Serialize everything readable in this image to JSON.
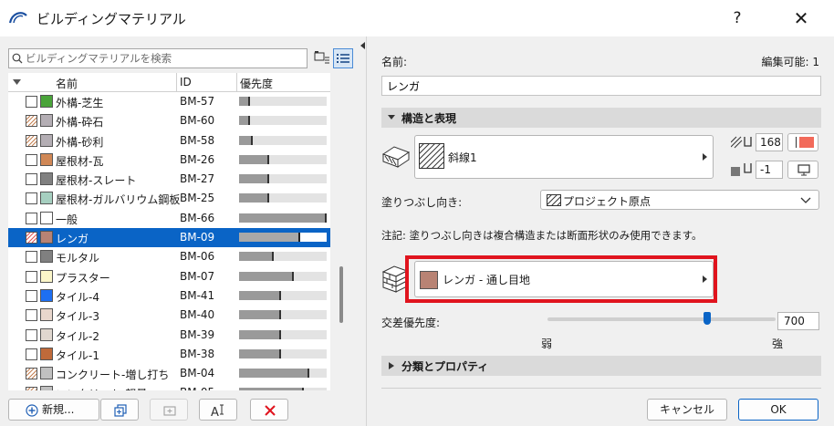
{
  "window": {
    "title": "ビルディングマテリアル",
    "help": "?",
    "close": "✕"
  },
  "search": {
    "placeholder": "ビルディングマテリアルを検索"
  },
  "list": {
    "headers": {
      "name": "名前",
      "id": "ID",
      "priority": "優先度"
    },
    "rows": [
      {
        "name": "外構-芝生",
        "id": "BM-57",
        "priority": 0.13,
        "swatch": "#4aa43a",
        "hatch": false,
        "selected": false
      },
      {
        "name": "外構-砕石",
        "id": "BM-60",
        "priority": 0.13,
        "swatch": "#b4aeb4",
        "hatch": true,
        "selected": false
      },
      {
        "name": "外構-砂利",
        "id": "BM-58",
        "priority": 0.16,
        "swatch": "#b4aeb4",
        "hatch": true,
        "selected": false
      },
      {
        "name": "屋根材-瓦",
        "id": "BM-26",
        "priority": 0.34,
        "swatch": "#d08856",
        "hatch": false,
        "selected": false
      },
      {
        "name": "屋根材-スレート",
        "id": "BM-27",
        "priority": 0.34,
        "swatch": "#808080",
        "hatch": false,
        "selected": false
      },
      {
        "name": "屋根材-ガルバリウム鋼板",
        "id": "BM-25",
        "priority": 0.34,
        "swatch": "#a6cfc0",
        "hatch": false,
        "selected": false
      },
      {
        "name": "一般",
        "id": "BM-66",
        "priority": 1.0,
        "swatch": "#ffffff",
        "hatch": false,
        "selected": false
      },
      {
        "name": "レンガ",
        "id": "BM-09",
        "priority": 0.7,
        "swatch": "#b88374",
        "hatch": true,
        "selected": true
      },
      {
        "name": "モルタル",
        "id": "BM-06",
        "priority": 0.4,
        "swatch": "#808080",
        "hatch": false,
        "selected": false
      },
      {
        "name": "プラスター",
        "id": "BM-07",
        "priority": 0.62,
        "swatch": "#fbf6c9",
        "hatch": false,
        "selected": false
      },
      {
        "name": "タイル-4",
        "id": "BM-41",
        "priority": 0.48,
        "swatch": "#1d6ff2",
        "hatch": false,
        "selected": false
      },
      {
        "name": "タイル-3",
        "id": "BM-40",
        "priority": 0.48,
        "swatch": "#e8d6cc",
        "hatch": false,
        "selected": false
      },
      {
        "name": "タイル-2",
        "id": "BM-39",
        "priority": 0.48,
        "swatch": "#e0d7cf",
        "hatch": false,
        "selected": false
      },
      {
        "name": "タイル-1",
        "id": "BM-38",
        "priority": 0.48,
        "swatch": "#bf6a3a",
        "hatch": false,
        "selected": false
      },
      {
        "name": "コンクリート-増し打ち",
        "id": "BM-04",
        "priority": 0.8,
        "swatch": "#c0c0c0",
        "hatch": true,
        "selected": false
      },
      {
        "name": "コンクリート-軽量",
        "id": "BM-05",
        "priority": 0.74,
        "swatch": "#c0c0c0",
        "hatch": true,
        "selected": false
      }
    ]
  },
  "bottom_buttons": {
    "new": "新規...",
    "cancel": "キャンセル",
    "ok": "OK"
  },
  "detail": {
    "name_label": "名前:",
    "editable": "編集可能: 1",
    "name_value": "レンガ",
    "structure_section": "構造と表現",
    "cut_fill": "斜線1",
    "pen_fg": "168",
    "pen_bg": "-1",
    "orientation_label": "塗りつぶし向き:",
    "orientation_value": "プロジェクト原点",
    "note": "注記: 塗りつぶし向きは複合構造または断面形状のみ使用できます。",
    "surface": "レンガ - 通し目地",
    "surface_color": "#b88374",
    "intersection_label": "交差優先度:",
    "intersection_value": "700",
    "intersection_level": 0.7,
    "weak": "弱",
    "strong": "強",
    "category_section": "分類とプロパティ"
  },
  "colors": {
    "accent": "#0a64c6",
    "highlight": "#e0141e",
    "pen_fg_color": "#f26a5a"
  }
}
